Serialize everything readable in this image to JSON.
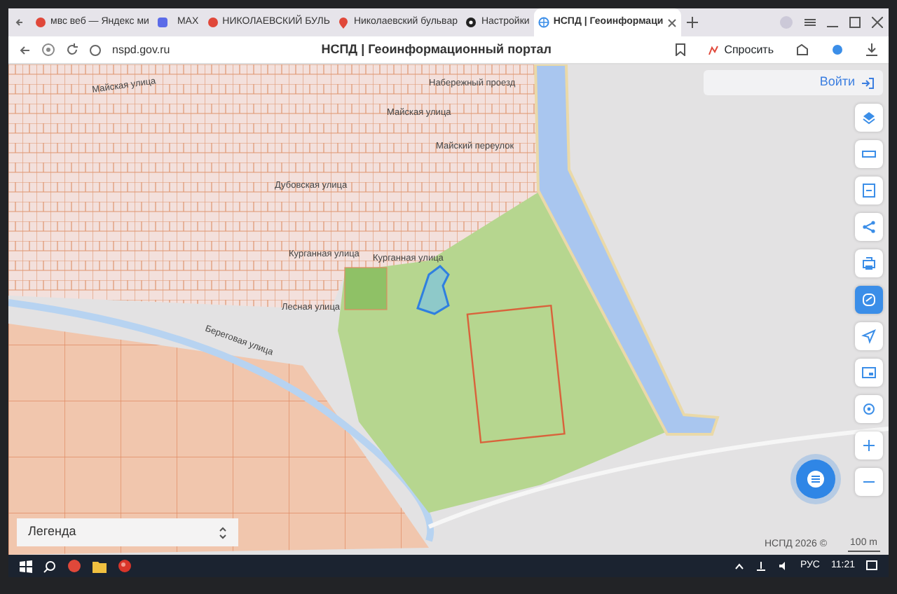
{
  "browser": {
    "tabs": [
      {
        "kind": "circle",
        "label": "мвс веб — Яндекс ми",
        "selected": false
      },
      {
        "kind": "square",
        "selected": false
      },
      {
        "kind": "plain",
        "label": "МАХ",
        "selected": false
      },
      {
        "kind": "circle",
        "label": "НИКОЛАЕВСКИЙ БУЛЬ",
        "selected": false
      },
      {
        "kind": "pin",
        "label": "Николаевский бульвар",
        "selected": false
      },
      {
        "kind": "gear",
        "label": "Настройки",
        "selected": false
      },
      {
        "kind": "globe",
        "label": "НСПД | Геоинформаци",
        "selected": true
      }
    ],
    "address": "nspd.gov.ru",
    "page_title": "НСПД | Геоинформационный портал",
    "ask_button": "Спросить"
  },
  "map": {
    "labels": [
      {
        "text": "Майская улица"
      },
      {
        "text": "Набережный проезд"
      },
      {
        "text": "Майская улица"
      },
      {
        "text": "Майский переулок"
      },
      {
        "text": "Дубовская улица"
      },
      {
        "text": "Курганная улица"
      },
      {
        "text": "Курганная улица"
      },
      {
        "text": "Лесная улица"
      },
      {
        "text": "Береговая улица"
      }
    ],
    "login_button": "Войти",
    "tools": [
      {
        "kind": "layers",
        "selected": false
      },
      {
        "kind": "ruler",
        "selected": false
      },
      {
        "kind": "export",
        "selected": false
      },
      {
        "kind": "share",
        "selected": false
      },
      {
        "kind": "print",
        "selected": false
      },
      {
        "kind": "draw",
        "selected": true
      },
      {
        "kind": "locate",
        "selected": false
      },
      {
        "kind": "image",
        "selected": false
      },
      {
        "kind": "search",
        "selected": false
      },
      {
        "kind": "zoom-in",
        "selected": false
      },
      {
        "kind": "zoom-out",
        "selected": false
      }
    ],
    "legend": {
      "label": "Легенда"
    },
    "attribution": "НСПД 2026 ©",
    "scale": "100 m"
  },
  "taskbar": {
    "language": "РУС",
    "time": "11:21"
  }
}
